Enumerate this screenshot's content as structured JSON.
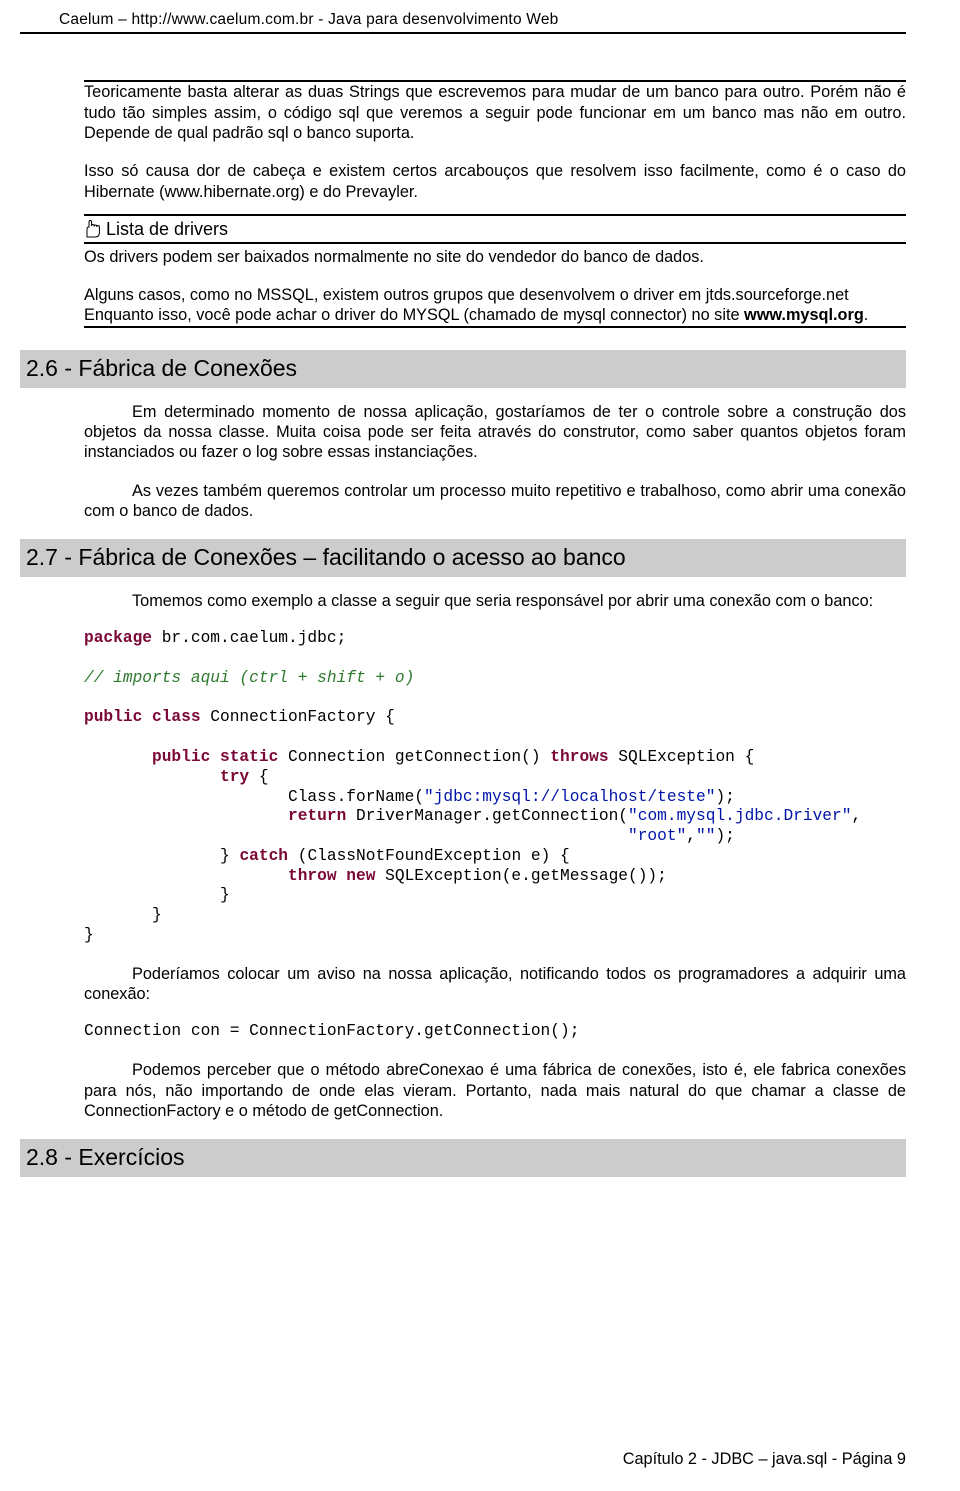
{
  "header": "Caelum – http://www.caelum.com.br - Java para desenvolvimento Web",
  "block1": {
    "p1": "Teoricamente basta alterar as duas Strings que escrevemos para mudar de um banco para outro. Porém não é tudo tão simples assim, o código sql que veremos a seguir pode funcionar em um banco mas não em outro. Depende de qual padrão sql o banco suporta.",
    "p2": "Isso só causa dor de cabeça e existem certos arcabouços que resolvem isso facilmente, como é o caso do Hibernate (www.hibernate.org) e do Prevayler."
  },
  "note": {
    "title": "Lista de drivers",
    "p1": "Os drivers podem ser baixados normalmente no site do vendedor do banco de dados.",
    "p2a": "Alguns casos, como no MSSQL, existem outros grupos que desenvolvem o driver em jtds.sourceforge.net",
    "p2b_pre": "Enquanto isso, você pode achar o driver do MYSQL (chamado de mysql connector) no site ",
    "p2b_bold": "www.mysql.org",
    "p2b_post": "."
  },
  "section26": {
    "title": "2.6 - Fábrica de Conexões",
    "p1": "Em determinado momento de nossa aplicação, gostaríamos de ter o controle sobre a construção dos objetos da nossa classe. Muita coisa pode ser feita através do construtor, como saber quantos objetos foram instanciados ou fazer o log sobre essas instanciações.",
    "p2": "As vezes também queremos controlar um processo muito repetitivo e trabalhoso, como abrir uma conexão com o banco de dados."
  },
  "section27": {
    "title": "2.7 - Fábrica de Conexões – facilitando o acesso ao banco",
    "intro": "Tomemos como exemplo a classe a seguir que seria responsável por abrir uma conexão com o banco:",
    "code": {
      "l1_kw": "package",
      "l1_rest": " br.com.caelum.jdbc;",
      "l2_cm": "// imports aqui (ctrl + shift + o)",
      "l3_kw": "public class",
      "l3_rest": " ConnectionFactory {",
      "l4_pre": "       ",
      "l4_kw": "public static",
      "l4_mid": " Connection getConnection() ",
      "l4_kw2": "throws",
      "l4_rest": " SQLException {",
      "l5_pre": "              ",
      "l5_kw": "try",
      "l5_rest": " {",
      "l6_pre": "                     Class.forName(",
      "l6_str": "\"jdbc:mysql://localhost/teste\"",
      "l6_rest": ");",
      "l7_pre": "                     ",
      "l7_kw": "return",
      "l7_mid": " DriverManager.getConnection(",
      "l7_str": "\"com.mysql.jdbc.Driver\"",
      "l7_rest": ",",
      "l8_pre": "                                                        ",
      "l8_str1": "\"root\"",
      "l8_mid": ",",
      "l8_str2": "\"\"",
      "l8_rest": ");",
      "l9_pre": "              } ",
      "l9_kw": "catch",
      "l9_rest": " (ClassNotFoundException e) {",
      "l10_pre": "                     ",
      "l10_kw": "throw new",
      "l10_rest": " SQLException(e.getMessage());",
      "l11": "              }",
      "l12": "       }",
      "l13": "}"
    },
    "p2": "Poderíamos colocar um aviso na nossa aplicação, notificando todos os programadores a adquirir uma conexão:",
    "code2": "Connection con = ConnectionFactory.getConnection();",
    "p3": "Podemos perceber que o método abreConexao é uma fábrica de conexões, isto é, ele fabrica conexões para nós, não importando de onde elas vieram. Portanto, nada mais natural do que chamar a classe de ConnectionFactory e o método de getConnection."
  },
  "section28": {
    "title": "2.8 - Exercícios"
  },
  "footer": "Capítulo 2 - JDBC – java.sql - Página 9"
}
